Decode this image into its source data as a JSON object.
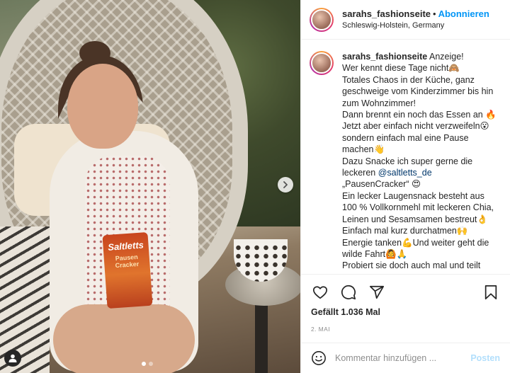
{
  "post": {
    "photo": {
      "bag_brand": "Saltletts",
      "bag_subtitle": "Pausen Cracker",
      "carousel": {
        "count": 2,
        "active_index": 0
      }
    },
    "header": {
      "username": "sarahs_fashionseite",
      "separator": "•",
      "follow_label": "Abonnieren",
      "location": "Schleswig-Holstein, Germany"
    },
    "caption": {
      "username": "sarahs_fashionseite",
      "lines": [
        "Anzeige!",
        "Wer kennt diese Tage nicht🙈",
        "Totales Chaos in der Küche, ganz geschweige vom Kinderzimmer bis hin zum Wohnzimmer!",
        "Dann brennt ein noch das Essen an 🔥 Jetzt aber einfach nicht verzweifeln😮 sondern einfach mal eine Pause machen👋",
        "Dazu Snacke ich super gerne die leckeren ",
        "„PausenCracker“ 😍",
        "Ein lecker Laugensnack besteht aus 100 % Vollkornmehl mit leckeren Chia, Leinen und Sesamsamen bestreut👌",
        "Einfach mal kurz durchatmen🙌",
        "Energie tanken💪Und weiter geht die wilde Fahrt🙆🙏",
        "Probiert sie doch auch mal und teilt"
      ],
      "mention": "@saltletts_de"
    },
    "actions": {
      "like_icon": "heart-icon",
      "comment_icon": "comment-icon",
      "share_icon": "share-icon",
      "save_icon": "bookmark-icon",
      "likes_text": "Gefällt 1.036 Mal",
      "date": "2. Mai"
    },
    "comment_box": {
      "emoji_icon": "smiley-icon",
      "placeholder": "Kommentar hinzufügen ...",
      "post_label": "Posten"
    },
    "colors": {
      "link_blue": "#0095f6",
      "post_disabled": "#b2dffc",
      "text": "#262626",
      "muted": "#8e8e8e"
    }
  }
}
